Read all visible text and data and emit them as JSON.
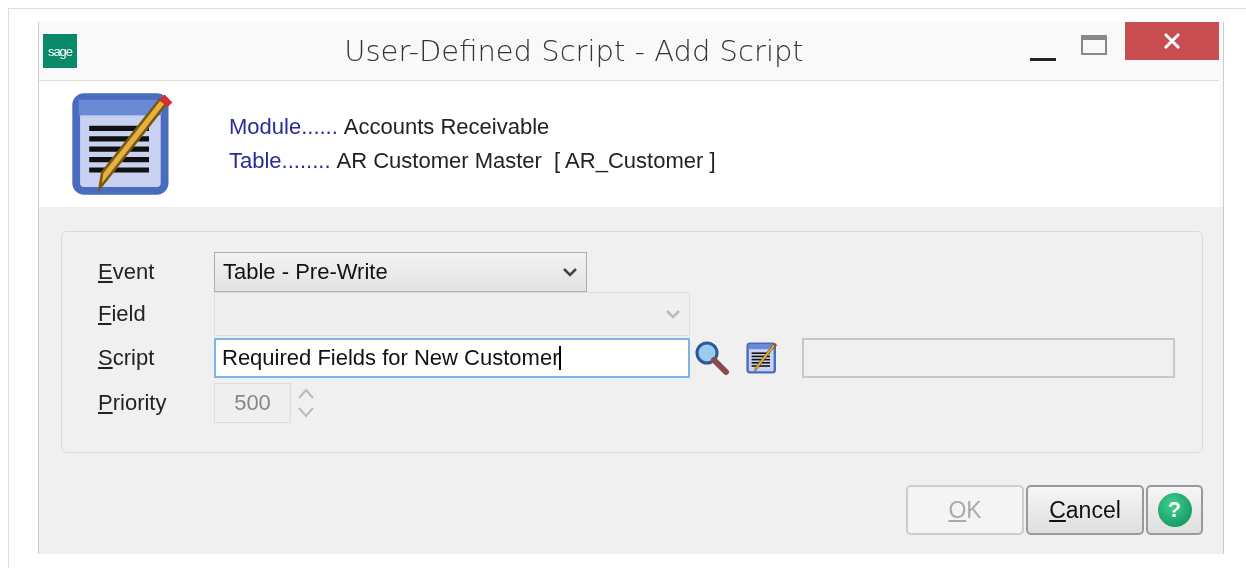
{
  "window": {
    "title": "User-Defined Script - Add Script",
    "logo": "sage"
  },
  "header": {
    "module_label": "Module......",
    "module_value": "Accounts Receivable",
    "table_label": "Table........",
    "table_value": "AR Customer Master  [ AR_Customer ]"
  },
  "form": [
    {
      "kind": "select",
      "label": "Event",
      "value": "Table - Pre-Write",
      "disabled": false
    },
    {
      "kind": "select",
      "label": "Field",
      "disabled": true
    },
    {
      "kind": "input",
      "label": "Script",
      "value": "Required Fields for New Customer",
      "focused": true
    },
    {
      "kind": "spinner",
      "label": "Priority",
      "value": "500",
      "disabled": true
    }
  ],
  "buttons": [
    {
      "label": "OK",
      "disabled": true
    },
    {
      "label": "Cancel",
      "disabled": false
    }
  ],
  "help": {
    "label": "?"
  }
}
